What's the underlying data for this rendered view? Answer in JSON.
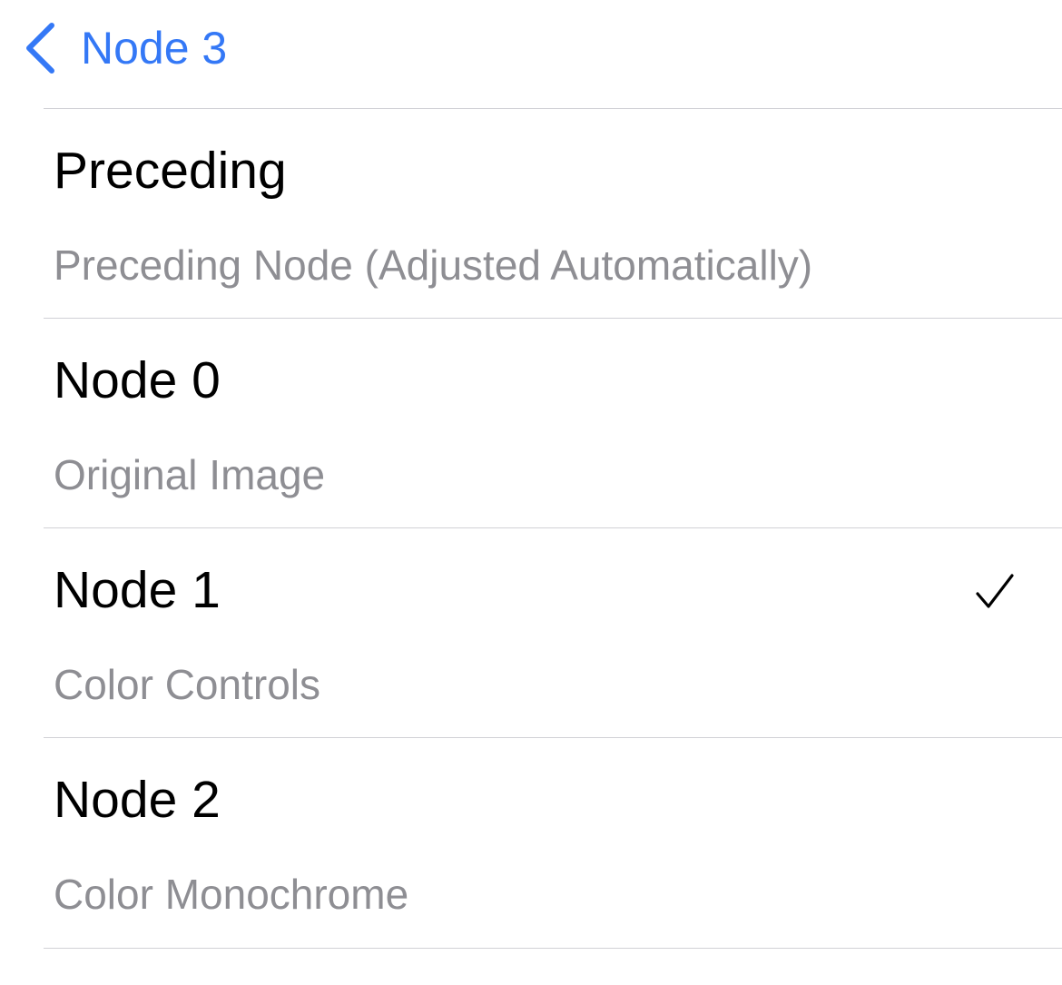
{
  "nav": {
    "back_label": "Node 3",
    "back_icon": "chevron-left-icon",
    "accent_color": "#3478f6"
  },
  "list": {
    "items": [
      {
        "title": "Preceding",
        "subtitle": "Preceding Node (Adjusted Automatically)",
        "selected": false
      },
      {
        "title": "Node 0",
        "subtitle": "Original Image",
        "selected": false
      },
      {
        "title": "Node 1",
        "subtitle": "Color Controls",
        "selected": true
      },
      {
        "title": "Node 2",
        "subtitle": "Color Monochrome",
        "selected": false
      }
    ],
    "check_icon": "checkmark-icon"
  }
}
